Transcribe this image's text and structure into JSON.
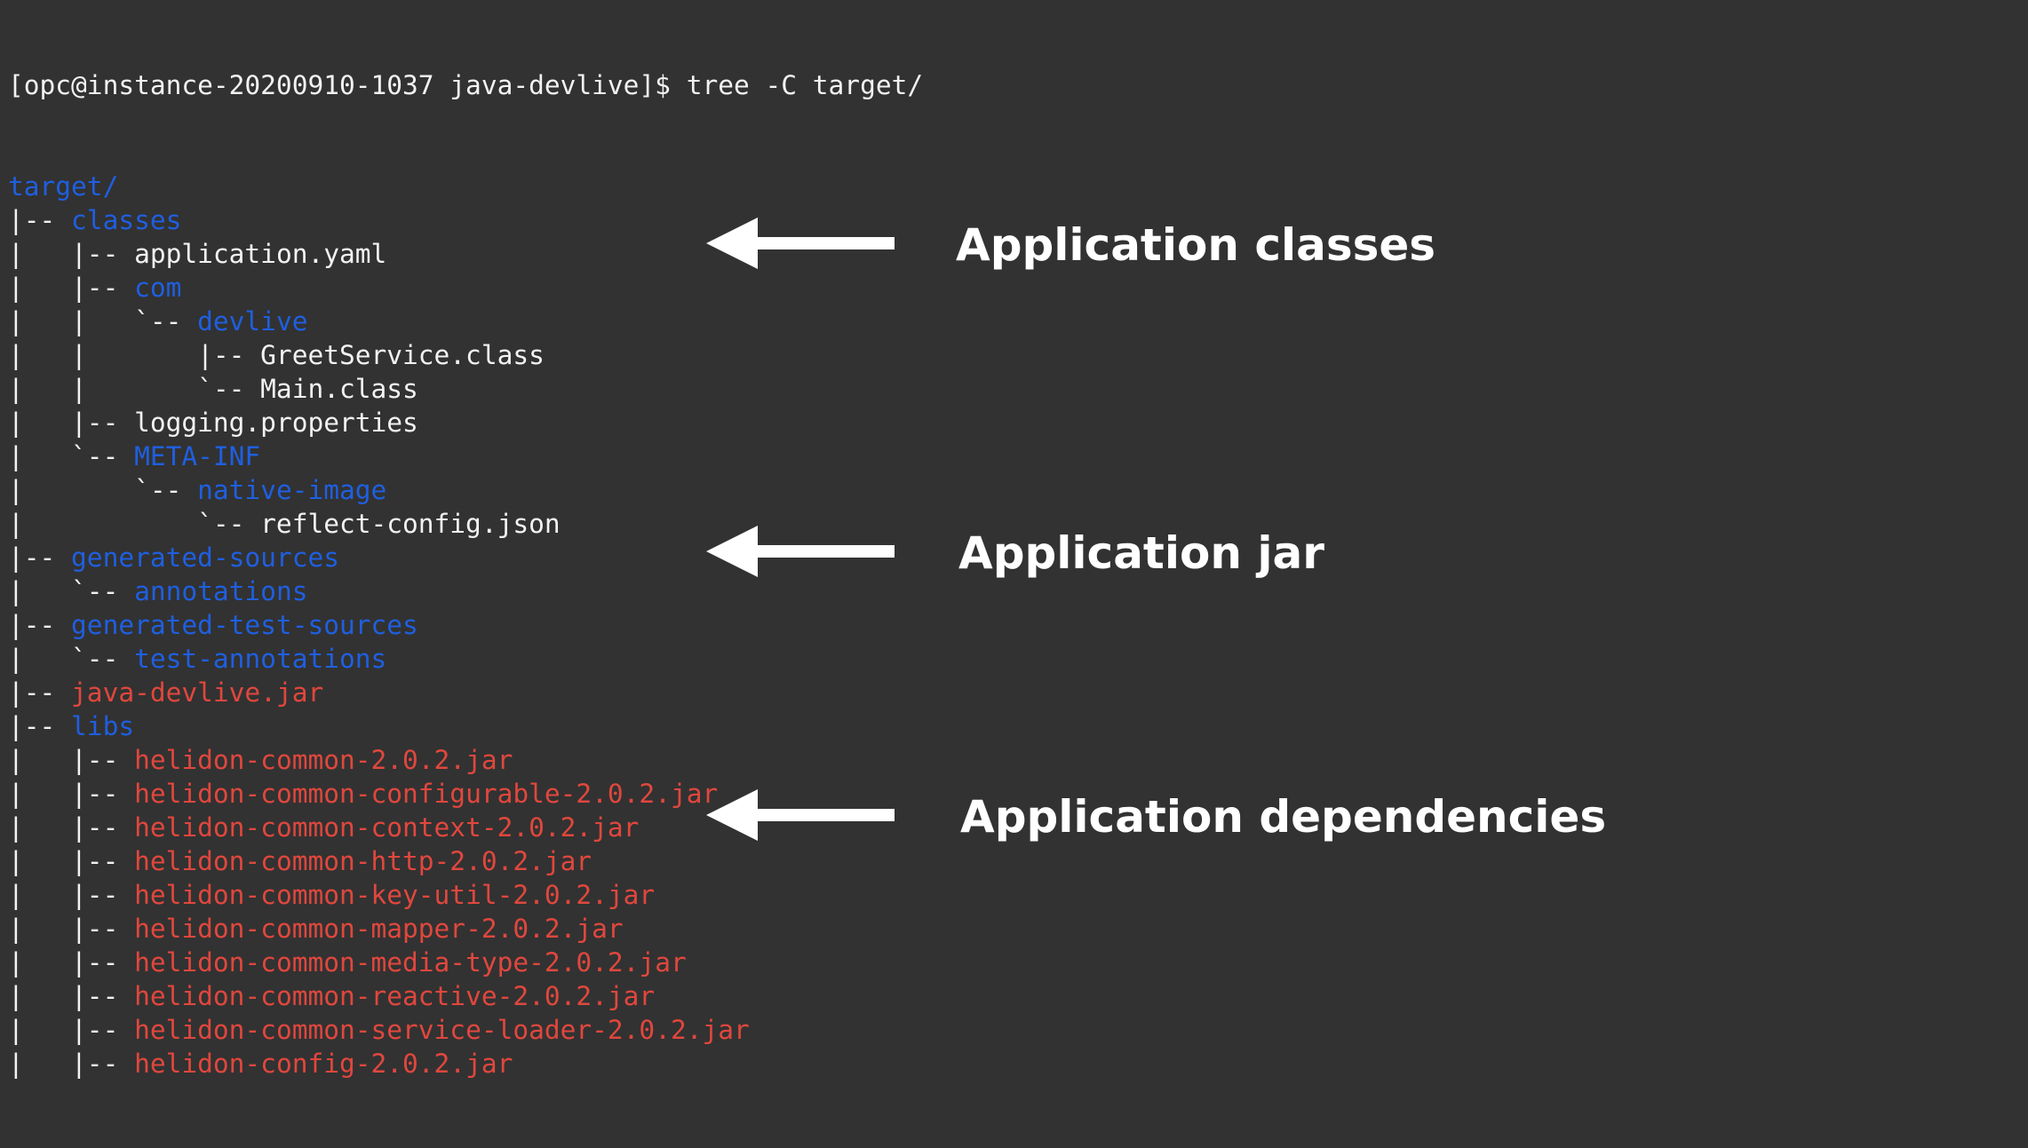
{
  "terminal": {
    "prompt": "[opc@instance-20200910-1037 java-devlive]$ tree -C target/",
    "lines": [
      {
        "prefix": "",
        "name": "target/",
        "kind": "dir"
      },
      {
        "prefix": "|-- ",
        "name": "classes",
        "kind": "dir"
      },
      {
        "prefix": "|   |-- ",
        "name": "application.yaml",
        "kind": "file"
      },
      {
        "prefix": "|   |-- ",
        "name": "com",
        "kind": "dir"
      },
      {
        "prefix": "|   |   `-- ",
        "name": "devlive",
        "kind": "dir"
      },
      {
        "prefix": "|   |       |-- ",
        "name": "GreetService.class",
        "kind": "file"
      },
      {
        "prefix": "|   |       `-- ",
        "name": "Main.class",
        "kind": "file"
      },
      {
        "prefix": "|   |-- ",
        "name": "logging.properties",
        "kind": "file"
      },
      {
        "prefix": "|   `-- ",
        "name": "META-INF",
        "kind": "dir"
      },
      {
        "prefix": "|       `-- ",
        "name": "native-image",
        "kind": "dir"
      },
      {
        "prefix": "|           `-- ",
        "name": "reflect-config.json",
        "kind": "file"
      },
      {
        "prefix": "|-- ",
        "name": "generated-sources",
        "kind": "dir"
      },
      {
        "prefix": "|   `-- ",
        "name": "annotations",
        "kind": "dir"
      },
      {
        "prefix": "|-- ",
        "name": "generated-test-sources",
        "kind": "dir"
      },
      {
        "prefix": "|   `-- ",
        "name": "test-annotations",
        "kind": "dir"
      },
      {
        "prefix": "|-- ",
        "name": "java-devlive.jar",
        "kind": "jar"
      },
      {
        "prefix": "|-- ",
        "name": "libs",
        "kind": "dir"
      },
      {
        "prefix": "|   |-- ",
        "name": "helidon-common-2.0.2.jar",
        "kind": "jar"
      },
      {
        "prefix": "|   |-- ",
        "name": "helidon-common-configurable-2.0.2.jar",
        "kind": "jar"
      },
      {
        "prefix": "|   |-- ",
        "name": "helidon-common-context-2.0.2.jar",
        "kind": "jar"
      },
      {
        "prefix": "|   |-- ",
        "name": "helidon-common-http-2.0.2.jar",
        "kind": "jar"
      },
      {
        "prefix": "|   |-- ",
        "name": "helidon-common-key-util-2.0.2.jar",
        "kind": "jar"
      },
      {
        "prefix": "|   |-- ",
        "name": "helidon-common-mapper-2.0.2.jar",
        "kind": "jar"
      },
      {
        "prefix": "|   |-- ",
        "name": "helidon-common-media-type-2.0.2.jar",
        "kind": "jar"
      },
      {
        "prefix": "|   |-- ",
        "name": "helidon-common-reactive-2.0.2.jar",
        "kind": "jar"
      },
      {
        "prefix": "|   |-- ",
        "name": "helidon-common-service-loader-2.0.2.jar",
        "kind": "jar"
      },
      {
        "prefix": "|   |-- ",
        "name": "helidon-config-2.0.2.jar",
        "kind": "jar"
      }
    ]
  },
  "callouts": {
    "classes": "Application classes",
    "jar": "Application jar",
    "dependencies": "Application dependencies"
  },
  "colors": {
    "background": "#323232",
    "directory": "#1f5fe0",
    "jar": "#e0473d",
    "text": "#f2f2f2"
  }
}
